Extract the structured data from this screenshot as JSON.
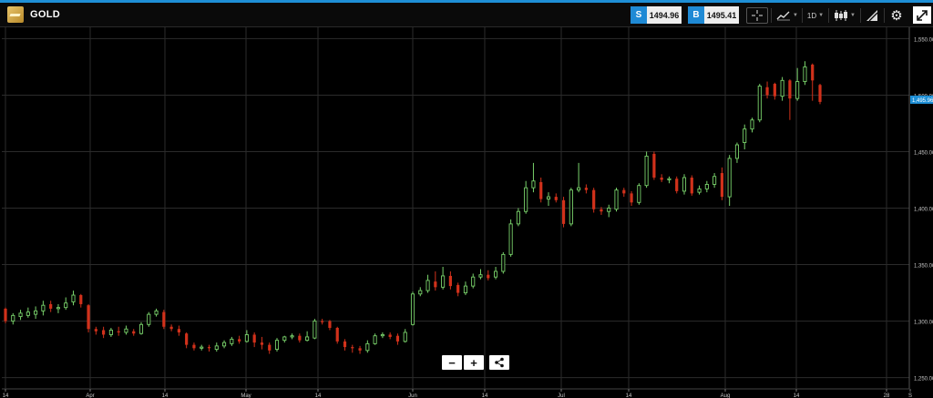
{
  "header": {
    "instrument": "GOLD",
    "sell_tag": "S",
    "sell_price": "1494.96",
    "buy_tag": "B",
    "buy_price": "1495.41",
    "timeframe": "1D",
    "icons": [
      "crosshair-icon",
      "chart-type-icon",
      "candlestick-icon",
      "drawing-tools-icon",
      "gear-icon",
      "expand-icon"
    ]
  },
  "chart_data": {
    "type": "candlestick",
    "ylim": [
      1240,
      1560
    ],
    "y_ticks": [
      1250,
      1300,
      1350,
      1400,
      1450,
      1500,
      1550
    ],
    "y_tick_labels": [
      "1,250.00",
      "1,300.00",
      "1,350.00",
      "1,400.00",
      "1,450.00",
      "1,500.00",
      "1,550.00"
    ],
    "current_price_label": "1,495.96",
    "x_ticks": [
      "14",
      "Apr",
      "14",
      "May",
      "14",
      "Jun",
      "14",
      "Jul",
      "14",
      "Aug",
      "14",
      "28",
      "S"
    ],
    "colors": {
      "up": "#79d26b",
      "down": "#d1311b",
      "grid": "#2b2b2b",
      "current": "#1e8fd6"
    },
    "candles": [
      [
        1311,
        1300,
        1312,
        1298
      ],
      [
        1300,
        1305,
        1307,
        1297
      ],
      [
        1304,
        1307,
        1310,
        1301
      ],
      [
        1305,
        1308,
        1312,
        1303
      ],
      [
        1306,
        1309,
        1313,
        1302
      ],
      [
        1309,
        1314,
        1318,
        1305
      ],
      [
        1315,
        1311,
        1318,
        1308
      ],
      [
        1311,
        1312,
        1315,
        1307
      ],
      [
        1312,
        1316,
        1321,
        1310
      ],
      [
        1317,
        1323,
        1327,
        1314
      ],
      [
        1323,
        1315,
        1324,
        1312
      ],
      [
        1314,
        1293,
        1315,
        1290
      ],
      [
        1293,
        1291,
        1295,
        1288
      ],
      [
        1292,
        1288,
        1295,
        1285
      ],
      [
        1288,
        1292,
        1294,
        1286
      ],
      [
        1291,
        1290,
        1295,
        1287
      ],
      [
        1290,
        1293,
        1296,
        1288
      ],
      [
        1291,
        1289,
        1293,
        1287
      ],
      [
        1289,
        1297,
        1299,
        1288
      ],
      [
        1297,
        1306,
        1308,
        1295
      ],
      [
        1306,
        1309,
        1311,
        1304
      ],
      [
        1308,
        1295,
        1310,
        1293
      ],
      [
        1295,
        1293,
        1297,
        1291
      ],
      [
        1293,
        1290,
        1296,
        1287
      ],
      [
        1289,
        1279,
        1290,
        1276
      ],
      [
        1279,
        1276,
        1281,
        1274
      ],
      [
        1276,
        1277,
        1279,
        1274
      ],
      [
        1277,
        1276,
        1279,
        1273
      ],
      [
        1275,
        1278,
        1281,
        1273
      ],
      [
        1278,
        1281,
        1283,
        1276
      ],
      [
        1280,
        1284,
        1286,
        1278
      ],
      [
        1284,
        1282,
        1287,
        1280
      ],
      [
        1282,
        1288,
        1292,
        1281
      ],
      [
        1288,
        1281,
        1290,
        1277
      ],
      [
        1281,
        1279,
        1286,
        1275
      ],
      [
        1279,
        1274,
        1281,
        1271
      ],
      [
        1275,
        1283,
        1285,
        1273
      ],
      [
        1283,
        1286,
        1287,
        1281
      ],
      [
        1286,
        1287,
        1289,
        1284
      ],
      [
        1287,
        1283,
        1289,
        1281
      ],
      [
        1283,
        1286,
        1291,
        1282
      ],
      [
        1285,
        1300,
        1302,
        1284
      ],
      [
        1300,
        1299,
        1302,
        1297
      ],
      [
        1300,
        1294,
        1301,
        1292
      ],
      [
        1294,
        1282,
        1295,
        1280
      ],
      [
        1282,
        1277,
        1284,
        1274
      ],
      [
        1277,
        1276,
        1279,
        1272
      ],
      [
        1276,
        1274,
        1278,
        1271
      ],
      [
        1274,
        1280,
        1283,
        1272
      ],
      [
        1280,
        1287,
        1289,
        1279
      ],
      [
        1287,
        1288,
        1290,
        1285
      ],
      [
        1288,
        1286,
        1290,
        1284
      ],
      [
        1287,
        1282,
        1289,
        1279
      ],
      [
        1282,
        1290,
        1293,
        1281
      ],
      [
        1297,
        1324,
        1326,
        1296
      ],
      [
        1324,
        1327,
        1330,
        1322
      ],
      [
        1327,
        1336,
        1341,
        1325
      ],
      [
        1335,
        1330,
        1344,
        1327
      ],
      [
        1330,
        1340,
        1348,
        1328
      ],
      [
        1340,
        1331,
        1344,
        1328
      ],
      [
        1332,
        1325,
        1334,
        1322
      ],
      [
        1325,
        1331,
        1335,
        1323
      ],
      [
        1331,
        1339,
        1342,
        1329
      ],
      [
        1339,
        1341,
        1346,
        1337
      ],
      [
        1341,
        1338,
        1345,
        1336
      ],
      [
        1339,
        1344,
        1348,
        1337
      ],
      [
        1344,
        1359,
        1361,
        1342
      ],
      [
        1359,
        1386,
        1390,
        1357
      ],
      [
        1386,
        1397,
        1400,
        1384
      ],
      [
        1397,
        1418,
        1424,
        1395
      ],
      [
        1418,
        1424,
        1440,
        1414
      ],
      [
        1423,
        1408,
        1427,
        1405
      ],
      [
        1408,
        1410,
        1414,
        1402
      ],
      [
        1410,
        1407,
        1413,
        1405
      ],
      [
        1407,
        1386,
        1410,
        1383
      ],
      [
        1386,
        1416,
        1418,
        1384
      ],
      [
        1416,
        1418,
        1440,
        1414
      ],
      [
        1418,
        1416,
        1421,
        1413
      ],
      [
        1416,
        1399,
        1418,
        1396
      ],
      [
        1399,
        1397,
        1401,
        1394
      ],
      [
        1397,
        1400,
        1403,
        1392
      ],
      [
        1399,
        1416,
        1418,
        1397
      ],
      [
        1416,
        1413,
        1418,
        1410
      ],
      [
        1413,
        1405,
        1415,
        1402
      ],
      [
        1405,
        1420,
        1422,
        1403
      ],
      [
        1420,
        1446,
        1450,
        1418
      ],
      [
        1448,
        1427,
        1450,
        1425
      ],
      [
        1427,
        1425,
        1430,
        1423
      ],
      [
        1425,
        1426,
        1428,
        1422
      ],
      [
        1426,
        1415,
        1428,
        1413
      ],
      [
        1415,
        1427,
        1430,
        1412
      ],
      [
        1427,
        1413,
        1429,
        1411
      ],
      [
        1414,
        1417,
        1420,
        1412
      ],
      [
        1417,
        1421,
        1424,
        1414
      ],
      [
        1421,
        1428,
        1431,
        1418
      ],
      [
        1431,
        1410,
        1436,
        1407
      ],
      [
        1410,
        1444,
        1447,
        1402
      ],
      [
        1444,
        1456,
        1458,
        1440
      ],
      [
        1458,
        1470,
        1474,
        1452
      ],
      [
        1470,
        1478,
        1480,
        1467
      ],
      [
        1478,
        1508,
        1510,
        1476
      ],
      [
        1507,
        1500,
        1512,
        1497
      ],
      [
        1510,
        1499,
        1511,
        1496
      ],
      [
        1499,
        1513,
        1516,
        1495
      ],
      [
        1513,
        1497,
        1514,
        1478
      ],
      [
        1497,
        1512,
        1524,
        1495
      ],
      [
        1512,
        1525,
        1530,
        1509
      ],
      [
        1527,
        1513,
        1528,
        1495
      ],
      [
        1509,
        1494,
        1510,
        1492
      ]
    ]
  }
}
